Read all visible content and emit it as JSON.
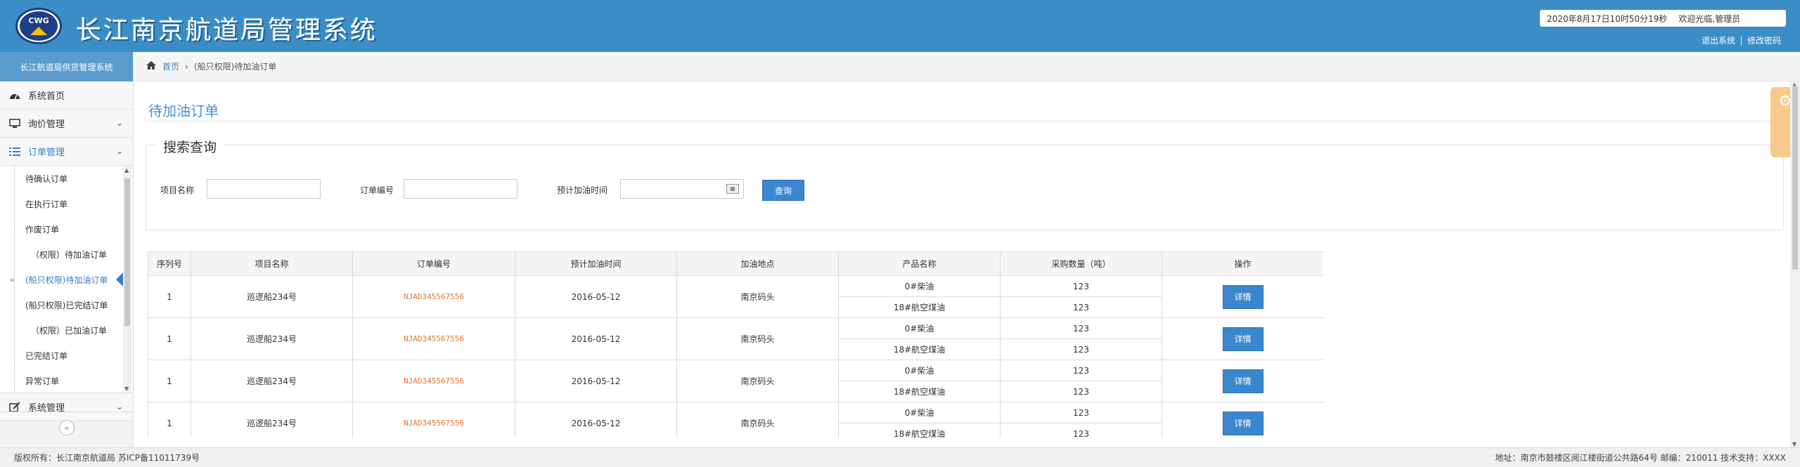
{
  "header": {
    "logo_text": "CWG",
    "app_title": "长江南京航道局管理系统",
    "datetime": "2020年8月17日10时50分19秒",
    "welcome": "欢迎光临,管理员",
    "logout": "退出系统",
    "change_password": "修改密码"
  },
  "sidebar": {
    "title": "长江航道局供货管理系统",
    "items": [
      {
        "label": "系统首页",
        "icon": "dashboard-icon"
      },
      {
        "label": "询价管理",
        "icon": "monitor-icon"
      },
      {
        "label": "订单管理",
        "icon": "list-icon"
      },
      {
        "label": "系统管理",
        "icon": "edit-icon"
      }
    ],
    "sub_items": [
      "待确认订单",
      "在执行订单",
      "作废订单",
      "（权限）待加油订单",
      "(船只权限)待加油订单",
      "(船只权限)已完结订单",
      "（权限）已加油订单",
      "已完结订单",
      "异常订单"
    ],
    "collapse_glyph": "«"
  },
  "breadcrumb": {
    "home": "首页",
    "sep": "›",
    "current": "(船只权限)待加油订单"
  },
  "page": {
    "title": "待加油订单"
  },
  "search": {
    "legend": "搜索查询",
    "project_label": "项目名称",
    "order_label": "订单编号",
    "time_label": "预计加油时间",
    "project_value": "",
    "order_value": "",
    "time_value": "",
    "query_button": "查询"
  },
  "table": {
    "headers": [
      "序列号",
      "项目名称",
      "订单编号",
      "预计加油时间",
      "加油地点",
      "产品名称",
      "采购数量（吨）",
      "操作"
    ],
    "detail_label": "详情",
    "rows": [
      {
        "seq": "1",
        "project": "巡逻船234号",
        "order": "NJAD345567556",
        "date": "2016-05-12",
        "place": "南京码头",
        "products": [
          {
            "name": "0#柴油",
            "qty": "123"
          },
          {
            "name": "18#航空煤油",
            "qty": "123"
          }
        ]
      },
      {
        "seq": "1",
        "project": "巡逻船234号",
        "order": "NJAD345567556",
        "date": "2016-05-12",
        "place": "南京码头",
        "products": [
          {
            "name": "0#柴油",
            "qty": "123"
          },
          {
            "name": "18#航空煤油",
            "qty": "123"
          }
        ]
      },
      {
        "seq": "1",
        "project": "巡逻船234号",
        "order": "NJAD345567556",
        "date": "2016-05-12",
        "place": "南京码头",
        "products": [
          {
            "name": "0#柴油",
            "qty": "123"
          },
          {
            "name": "18#航空煤油",
            "qty": "123"
          }
        ]
      },
      {
        "seq": "1",
        "project": "巡逻船234号",
        "order": "NJAD345567556",
        "date": "2016-05-12",
        "place": "南京码头",
        "products": [
          {
            "name": "0#柴油",
            "qty": "123"
          },
          {
            "name": "18#航空煤油",
            "qty": "123"
          }
        ]
      }
    ]
  },
  "footer": {
    "left": "版权所有：长江南京航道局 苏ICP备11011739号",
    "right": "地址：南京市鼓楼区阅江楼街道公共路64号 邮编：210011 技术支持：XXXX"
  },
  "colors": {
    "header_bg": "#3b8dc5",
    "accent": "#3b87cf",
    "order_text": "#e8752e"
  }
}
